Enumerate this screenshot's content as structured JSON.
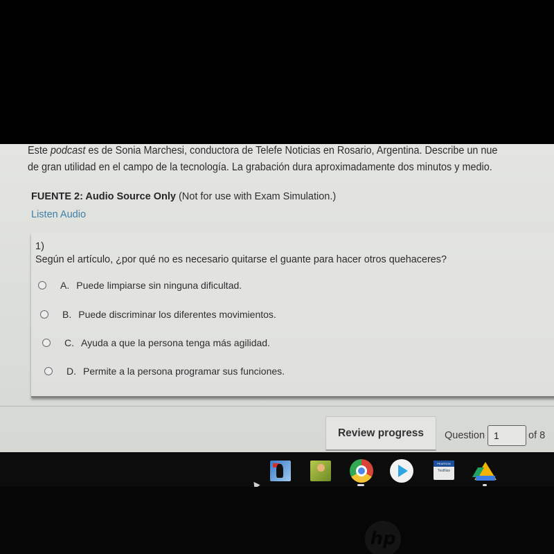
{
  "intro": {
    "line1_prefix": "Este ",
    "line1_italic": "podcast",
    "line1_rest": " es de Sonia Marchesi, conductora de Telefe Noticias en Rosario, Argentina. Describe un nue",
    "line2": "de gran utilidad en el campo de la tecnología. La grabación dura aproximadamente dos minutos y medio."
  },
  "source": {
    "title_bold": "FUENTE 2: Audio Source Only",
    "title_note": " (Not for use with Exam Simulation.)",
    "listen_link": "Listen Audio"
  },
  "question": {
    "number": "1)",
    "text": "Según el artículo, ¿por qué no es necesario quitarse el guante para hacer otros quehaceres?",
    "options": [
      {
        "letter": "A.",
        "text": "Puede limpiarse sin ninguna dificultad.",
        "selected": false
      },
      {
        "letter": "B.",
        "text": "Puede discriminar los diferentes movimientos.",
        "selected": false
      },
      {
        "letter": "C.",
        "text": "Ayuda a que la persona tenga más agilidad.",
        "selected": false
      },
      {
        "letter": "D.",
        "text": "Permite a la persona programar sus funciones.",
        "selected": false
      }
    ]
  },
  "footer": {
    "review_button": "Review progress",
    "question_label": "Question",
    "current_question": "1",
    "total_label": "of 8"
  },
  "taskbar": {
    "apps": [
      {
        "name": "superhero-game-icon",
        "running": false
      },
      {
        "name": "adventure-game-icon",
        "running": false
      },
      {
        "name": "chrome-icon",
        "running": true
      },
      {
        "name": "play-store-icon",
        "running": false
      },
      {
        "name": "pearson-testnav-icon",
        "label_top": "PEARSON",
        "label_bottom": "TestNav",
        "running": false
      },
      {
        "name": "google-drive-icon",
        "running": true
      }
    ]
  },
  "bezel": {
    "logo": "hp"
  }
}
